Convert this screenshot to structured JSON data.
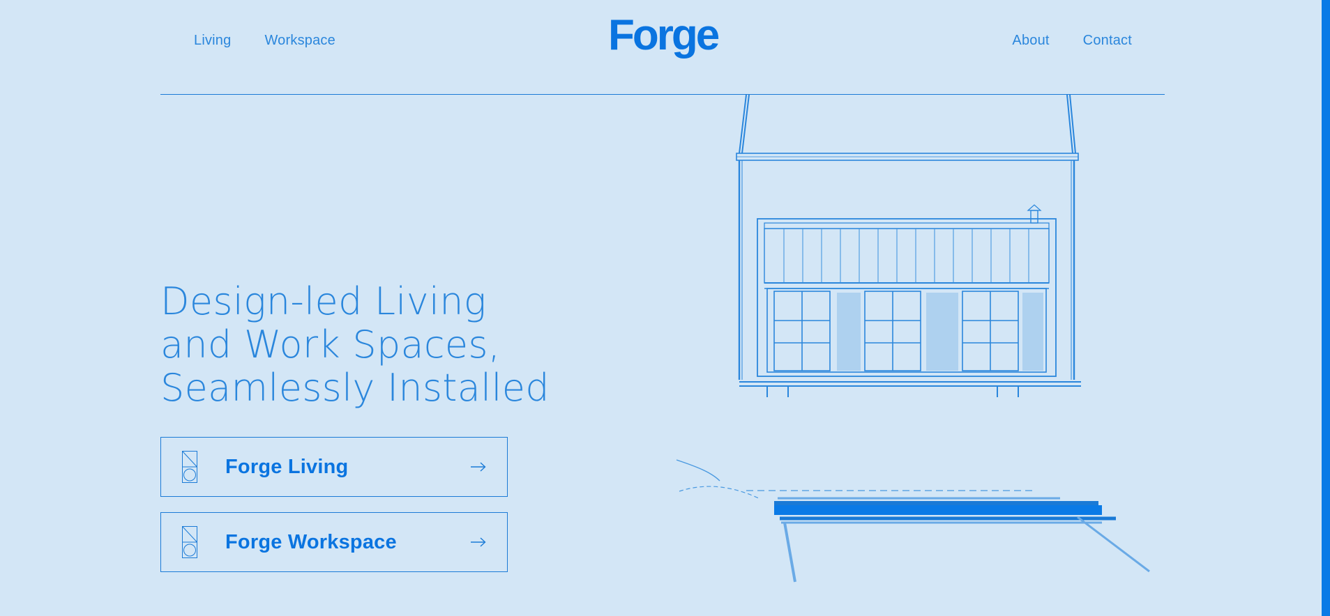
{
  "header": {
    "brand": "Forge",
    "nav_left": [
      {
        "label": "Living"
      },
      {
        "label": "Workspace"
      }
    ],
    "nav_right": [
      {
        "label": "About"
      },
      {
        "label": "Contact"
      }
    ]
  },
  "hero": {
    "headline": [
      "Design-led Living",
      "and Work Spaces,",
      "Seamlessly Installed"
    ],
    "cards": [
      {
        "label": "Forge Living",
        "icon": "forge-living-icon",
        "arrow": "arrow-right-icon"
      },
      {
        "label": "Forge Workspace",
        "icon": "forge-workspace-icon",
        "arrow": "arrow-right-icon"
      }
    ]
  },
  "colors": {
    "background": "#d3e6f6",
    "accent": "#0a74e0",
    "line": "#1a7ad6"
  }
}
